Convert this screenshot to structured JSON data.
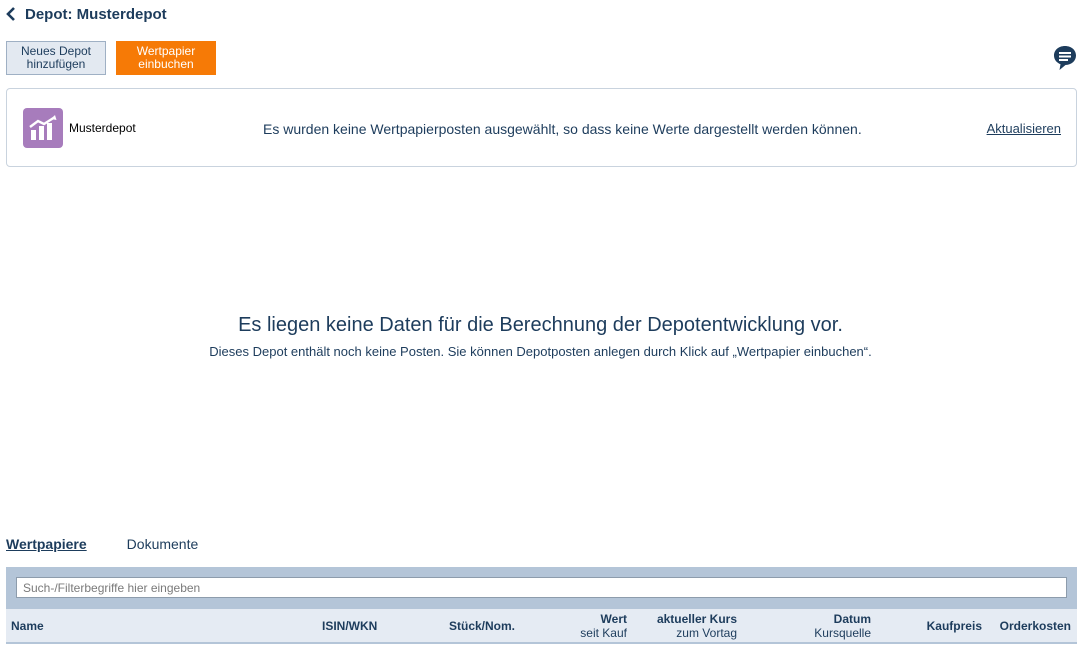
{
  "header": {
    "title": "Depot: Musterdepot",
    "back_icon": "chevron-left-icon"
  },
  "buttons": {
    "new_depot": "Neues Depot hinzufügen",
    "book_security": "Wertpapier einbuchen",
    "book_security_color": "#f67a06"
  },
  "chat_icon": "chat-bubble-icon",
  "info": {
    "depot_name": "Musterdepot",
    "logo_color": "#a77cbc",
    "message": "Es wurden keine Wertpapierposten ausgewählt, so dass keine Werte dargestellt werden können.",
    "refresh_label": "Aktualisieren"
  },
  "empty_state": {
    "title": "Es liegen keine Daten für die Berechnung der Depotentwicklung vor.",
    "subtitle": "Dieses Depot enthält noch keine Posten. Sie können Depotposten anlegen durch Klick auf „Wertpapier einbuchen“."
  },
  "tabs": [
    {
      "label": "Wertpapiere",
      "active": true
    },
    {
      "label": "Dokumente",
      "active": false
    }
  ],
  "search": {
    "placeholder": "Such-/Filterbegriffe hier eingeben",
    "value": ""
  },
  "table": {
    "columns": [
      {
        "label": "Name"
      },
      {
        "label": "ISIN/WKN"
      },
      {
        "label": "Stück/Nom."
      },
      {
        "label": "Wert",
        "sub": "seit Kauf"
      },
      {
        "label": "aktueller Kurs",
        "sub": "zum Vortag"
      },
      {
        "label": "Datum",
        "sub": "Kursquelle"
      },
      {
        "label": "Kaufpreis"
      },
      {
        "label": "Orderkosten"
      }
    ]
  }
}
